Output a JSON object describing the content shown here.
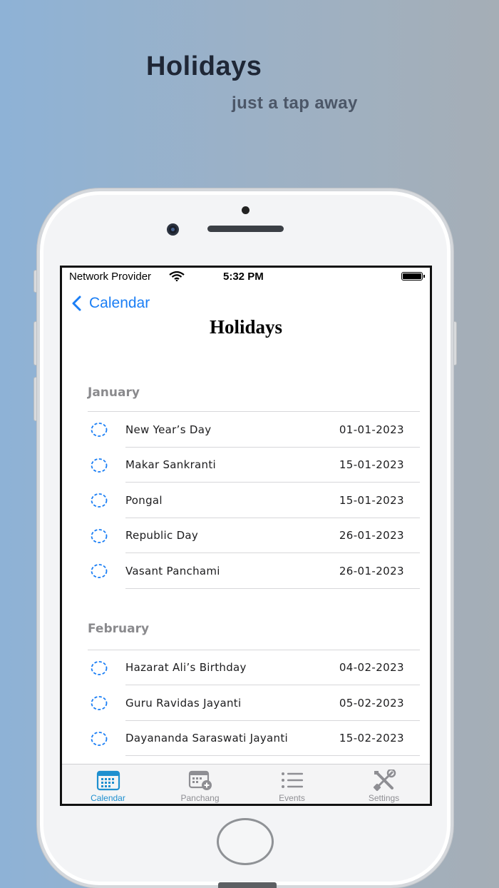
{
  "hero": {
    "title": "Holidays",
    "subtitle": "just a tap away"
  },
  "status_bar": {
    "carrier": "Network Provider",
    "time": "5:32 PM"
  },
  "nav": {
    "back_label": "Calendar",
    "title": "Holidays"
  },
  "sections": [
    {
      "header": "January",
      "items": [
        {
          "name": "New Year’s Day",
          "date": "01-01-2023"
        },
        {
          "name": "Makar Sankranti",
          "date": "15-01-2023"
        },
        {
          "name": "Pongal",
          "date": "15-01-2023"
        },
        {
          "name": "Republic Day",
          "date": "26-01-2023"
        },
        {
          "name": "Vasant Panchami",
          "date": "26-01-2023"
        }
      ]
    },
    {
      "header": "February",
      "items": [
        {
          "name": "Hazarat Ali’s Birthday",
          "date": "04-02-2023"
        },
        {
          "name": "Guru Ravidas Jayanti",
          "date": "05-02-2023"
        },
        {
          "name": "Dayananda Saraswati Jayanti",
          "date": "15-02-2023"
        }
      ]
    }
  ],
  "tab_bar": {
    "active": "calendar",
    "tabs": [
      {
        "id": "calendar",
        "label": "Calendar",
        "icon": "calendar-icon"
      },
      {
        "id": "panchang",
        "label": "Panchang",
        "icon": "calendar-add-icon"
      },
      {
        "id": "events",
        "label": "Events",
        "icon": "list-icon"
      },
      {
        "id": "settings",
        "label": "Settings",
        "icon": "tools-icon"
      }
    ]
  },
  "colors": {
    "accent": "#1a7ef5",
    "tab_active": "#1e8fcf",
    "section_header": "#8a8a8d"
  }
}
